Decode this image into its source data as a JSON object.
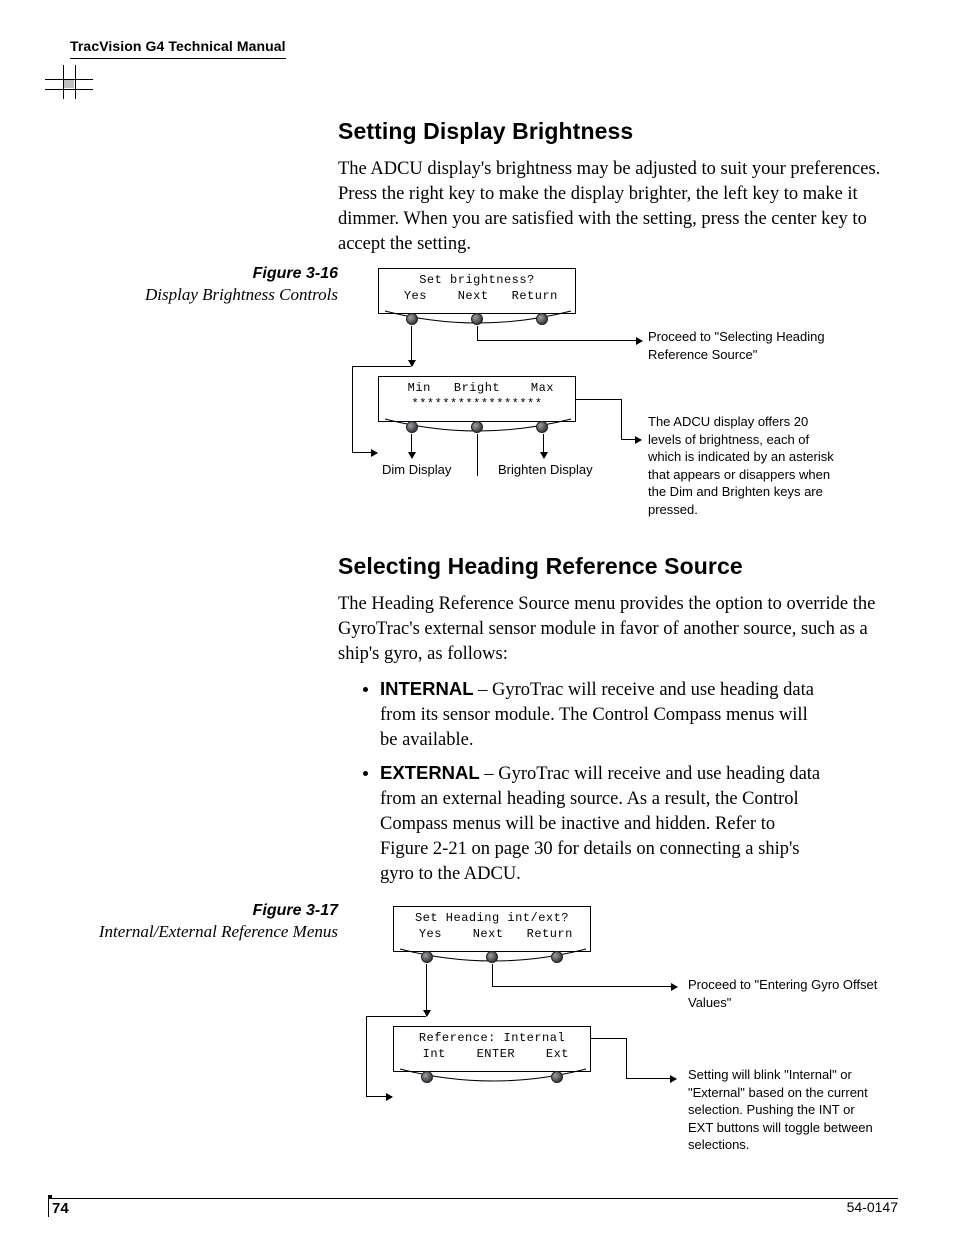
{
  "header": {
    "running_title": "TracVision G4 Technical Manual"
  },
  "sections": {
    "brightness": {
      "heading": "Setting Display Brightness",
      "para": "The ADCU display's brightness may be adjusted to suit your preferences. Press the right key to make the display brighter, the left key to make it dimmer. When you are satisfied with the setting, press the center key to accept the setting."
    },
    "heading_ref": {
      "heading": "Selecting Heading Reference Source",
      "para": "The Heading Reference Source menu provides the option to override the GyroTrac's external sensor module in favor of another source, such as a ship's gyro, as follows:",
      "internal_label": "INTERNAL",
      "internal_text": " – GyroTrac will receive and use heading data from its sensor module. The Control Compass menus will be available.",
      "external_label": "EXTERNAL",
      "external_text": " – GyroTrac will receive and use heading data from an external heading source. As a result, the Control Compass menus will be inactive and hidden. Refer to Figure 2-21 on page 30 for details on connecting a ship's gyro to the ADCU."
    }
  },
  "figures": {
    "f16": {
      "num": "Figure 3-16",
      "title": "Display Brightness Controls",
      "lcd1_line1": "Set brightness?",
      "lcd1_line2": " Yes    Next   Return",
      "lcd2_line1": " Min   Bright    Max",
      "lcd2_line2": "*****************",
      "label_dim": "Dim Display",
      "label_brighten": "Brighten Display",
      "note_a": "Proceed to \"Selecting Heading Reference Source\"",
      "note_b": "The ADCU display offers 20 levels of brightness, each of which is indicated by an asterisk that appears or disappers when the Dim and Brighten keys are pressed."
    },
    "f17": {
      "num": "Figure 3-17",
      "title": "Internal/External Reference Menus",
      "lcd1_line1": "Set Heading int/ext?",
      "lcd1_line2": " Yes    Next   Return",
      "lcd2_line1": "Reference: Internal",
      "lcd2_line2": " Int    ENTER    Ext",
      "note_a": "Proceed to \"Entering Gyro Offset Values\"",
      "note_b": "Setting will blink \"Internal\" or \"External\" based on the current selection. Pushing the INT or EXT buttons will toggle between selections."
    }
  },
  "footer": {
    "page": "74",
    "doc_id": "54-0147"
  }
}
